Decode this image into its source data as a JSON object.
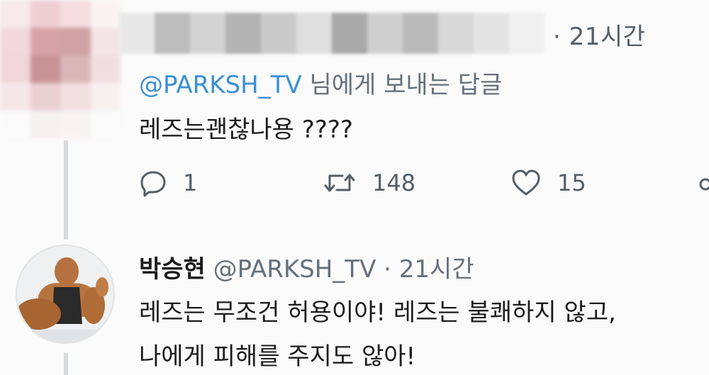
{
  "top_tweet": {
    "time": "· 21시간",
    "reply_to_handle": "@PARKSH_TV",
    "reply_to_suffix": " 님에게 보내는 답글",
    "text": "레즈는괜찮나용 ????",
    "reply_count": "1",
    "retweet_count": "148",
    "like_count": "15",
    "icons": [
      "reply-icon",
      "retweet-icon",
      "like-icon",
      "share-icon"
    ]
  },
  "bottom_tweet": {
    "name": "박승현",
    "handle": "@PARKSH_TV",
    "dot": "·",
    "time": "21시간",
    "line1": "레즈는 무조건 허용이야! 레즈는 불쾌하지 않고,",
    "line2": "나에게 피해를 주지도 않아!"
  },
  "colors": {
    "mention": "#3b8fd6",
    "muted": "#66707a",
    "thread_line": "#d6dade"
  }
}
